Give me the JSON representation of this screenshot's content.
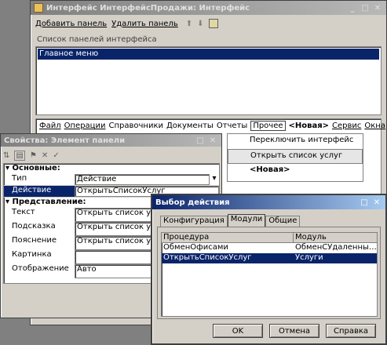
{
  "main_window": {
    "title": "Интерфейс ИнтерфейсПродажи: Интерфейс",
    "add_panel": "Добавить панель",
    "delete_panel": "Удалить панель",
    "panels_label": "Список панелей интерфейса",
    "panels": [
      "Главное меню"
    ],
    "menu": [
      "Файл",
      "Операции",
      "Справочники",
      "Документы",
      "Отчеты",
      "Прочее",
      "<Новая>",
      "Сервис",
      "Окна"
    ],
    "submenu": [
      "Переключить интерфейс",
      "Открыть список услуг",
      "<Новая>"
    ]
  },
  "props_window": {
    "title": "Свойства: Элемент панели",
    "section_basic": "Основные:",
    "section_view": "Представление:",
    "rows": [
      {
        "label": "Тип",
        "value": "Действие"
      },
      {
        "label": "Действие",
        "value": "ОткрытьСписокУслуг"
      },
      {
        "label": "Текст",
        "value": "Открыть список услуг"
      },
      {
        "label": "Подсказка",
        "value": "Открыть список услуг"
      },
      {
        "label": "Пояснение",
        "value": "Открыть список услуг"
      },
      {
        "label": "Картинка",
        "value": ""
      },
      {
        "label": "Отображение",
        "value": "Авто"
      }
    ]
  },
  "dialog": {
    "title": "Выбор действия",
    "tabs": [
      "Конфигурация",
      "Модули",
      "Общие"
    ],
    "col_procedure": "Процедура",
    "col_module": "Модуль",
    "rows": [
      {
        "procedure": "ОбменОфисами",
        "module": "ОбменСУдаленнымиОфисами"
      },
      {
        "procedure": "ОткрытьСписокУслуг",
        "module": "Услуги"
      }
    ],
    "ok": "OK",
    "cancel": "Отмена",
    "help": "Справка"
  }
}
